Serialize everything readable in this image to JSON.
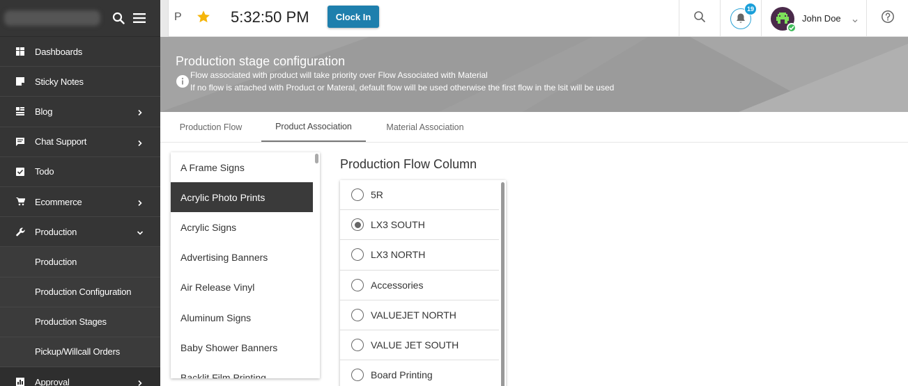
{
  "topbar": {
    "letter": "P",
    "clock": "5:32:50 PM",
    "clock_in_label": "Clock In",
    "notification_count": "19",
    "user_name": "John Doe"
  },
  "sidebar": {
    "items": [
      {
        "label": "Dashboards",
        "icon": "dashboard-icon"
      },
      {
        "label": "Sticky Notes",
        "icon": "note-icon"
      },
      {
        "label": "Blog",
        "icon": "blog-icon",
        "has_chevron": true
      },
      {
        "label": "Chat Support",
        "icon": "chat-icon",
        "has_chevron": true
      },
      {
        "label": "Todo",
        "icon": "checkbox-icon"
      },
      {
        "label": "Ecommerce",
        "icon": "cart-icon",
        "has_chevron": true
      },
      {
        "label": "Production",
        "icon": "wrench-icon",
        "expanded": true
      }
    ],
    "sub_items": [
      "Production",
      "Production Configuration",
      "Production Stages",
      "Pickup/Willcall Orders"
    ],
    "tail_item": {
      "label": "Approval",
      "icon": "approval-icon"
    }
  },
  "banner": {
    "title": "Production stage configuration",
    "line1": "Flow associated with product will take priority over Flow Associated with Material",
    "line2": "If no flow is attached with Product or Materal, default flow will be used otherwise the first flow in the lsit will be used"
  },
  "tabs": {
    "flow": "Production Flow",
    "product": "Product Association",
    "material": "Material Association",
    "active": "Product Association"
  },
  "products": {
    "items": [
      "A Frame Signs",
      "Acrylic Photo Prints",
      "Acrylic Signs",
      "Advertising Banners",
      "Air Release Vinyl",
      "Aluminum Signs",
      "Baby Shower Banners",
      "Backlit Film Printing"
    ],
    "selected": "Acrylic Photo Prints"
  },
  "flow_column": {
    "title": "Production Flow Column",
    "options": [
      "5R",
      "LX3 SOUTH",
      "LX3 NORTH",
      "Accessories",
      "VALUEJET NORTH",
      "VALUE JET SOUTH",
      "Board Printing"
    ],
    "selected": "LX3 SOUTH"
  },
  "colors": {
    "sidebar_bg": "#353535",
    "accent": "#1e7fad",
    "star": "#f5b50a",
    "banner": "#9b9b9b",
    "online": "#3ebc5a"
  }
}
